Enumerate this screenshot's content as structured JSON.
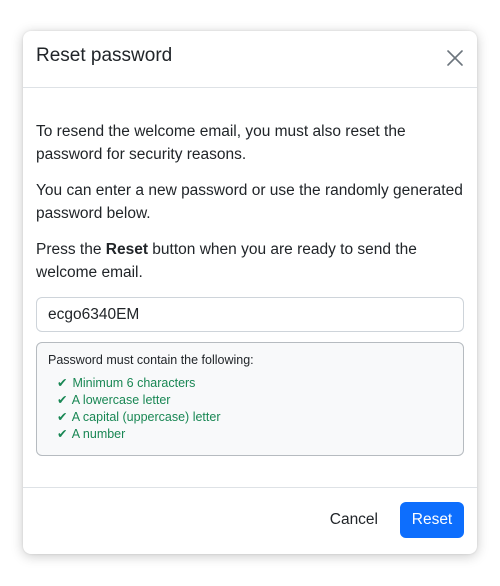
{
  "dialog": {
    "title": "Reset password",
    "close_icon": "close-icon"
  },
  "body": {
    "paragraph_1": "To resend the welcome email, you must also reset the password for security reasons.",
    "paragraph_2": "You can enter a new password or use the randomly generated password below.",
    "paragraph_3_prefix": "Press the ",
    "paragraph_3_bold": "Reset",
    "paragraph_3_suffix": " button when you are ready to send the welcome email.",
    "password_value": "ecgo6340EM"
  },
  "requirements": {
    "title": "Password must contain the following:",
    "check_icon": "checkmark-icon",
    "check_glyph": "✔",
    "items": [
      "Minimum 6 characters",
      "A lowercase letter",
      "A capital (uppercase) letter",
      "A number"
    ]
  },
  "footer": {
    "cancel_label": "Cancel",
    "reset_label": "Reset"
  },
  "colors": {
    "primary": "#0d6efd",
    "success": "#198754",
    "text": "#212529",
    "border": "#dee2e6"
  }
}
